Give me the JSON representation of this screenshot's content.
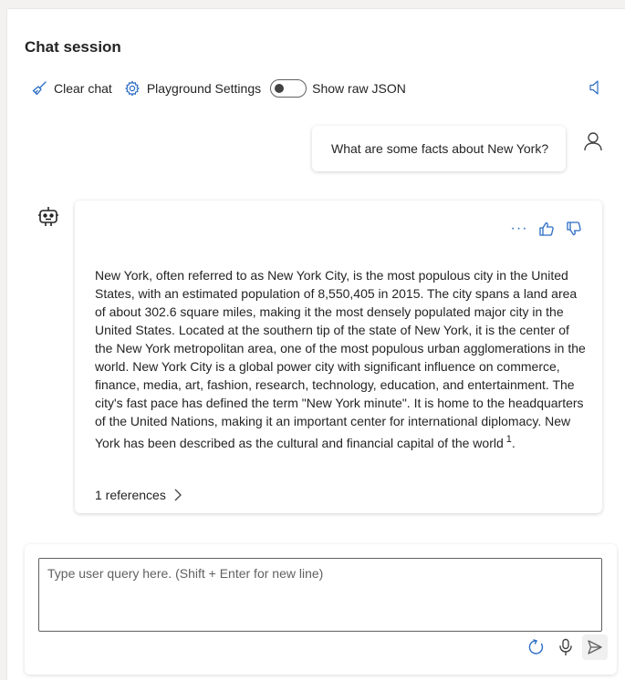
{
  "header": {
    "title": "Chat session"
  },
  "toolbar": {
    "clear_label": "Clear chat",
    "settings_label": "Playground Settings",
    "raw_json_label": "Show raw JSON",
    "raw_json_on": false
  },
  "conversation": {
    "user_message": "What are some facts about New York?",
    "assistant_message": {
      "text": "New York, often referred to as New York City, is the most populous city in the United States, with an estimated population of 8,550,405 in 2015. The city spans a land area of about 302.6 square miles, making it the most densely populated major city in the United States. Located at the southern tip of the state of New York, it is the center of the New York metropolitan area, one of the most populous urban agglomerations in the world. New York City is a global power city with significant influence on commerce, finance, media, art, fashion, research, technology, education, and entertainment. The city's fast pace has defined the term \"New York minute\". It is home to the headquarters of the United Nations, making it an important center for international diplomacy. New York has been described as the cultural and financial capital of the world",
      "citation": "1",
      "end": ".",
      "references_label": "1 references",
      "more_label": "···"
    }
  },
  "input": {
    "placeholder": "Type user query here. (Shift + Enter for new line)",
    "value": ""
  },
  "colors": {
    "accent": "#2b6cc4",
    "text": "#242424",
    "border": "#616161"
  },
  "icons": [
    "broom-icon",
    "gear-icon",
    "toggle-switch",
    "speaker-icon",
    "person-icon",
    "bot-icon",
    "more-icon",
    "thumbs-up-icon",
    "thumbs-down-icon",
    "chevron-right-icon",
    "refresh-icon",
    "microphone-icon",
    "send-icon"
  ]
}
